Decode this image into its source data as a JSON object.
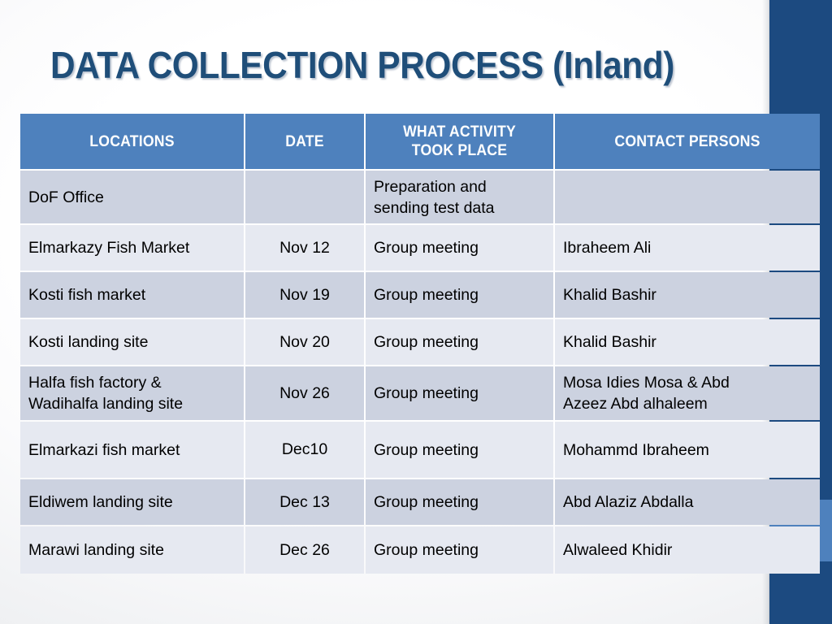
{
  "slide": {
    "title": "DATA COLLECTION PROCESS (Inland)",
    "accent_color": "#4e81bd",
    "title_color": "#1f4e79",
    "sidebar_color": "#1c4a80",
    "row_dark_color": "#ccd2e0",
    "row_light_color": "#e6e9f1"
  },
  "table": {
    "headers": {
      "locations": "LOCATIONS",
      "date": "DATE",
      "activity_line1": "WHAT ACTIVITY",
      "activity_line2": "TOOK PLACE",
      "contact": "CONTACT PERSONS"
    },
    "rows": [
      {
        "location": "DoF Office",
        "date": "",
        "activity": "Preparation and\nsending test data",
        "contact": ""
      },
      {
        "location": "Elmarkazy Fish Market",
        "date": "Nov 12",
        "activity": "Group meeting",
        "contact": "Ibraheem Ali"
      },
      {
        "location": "Kosti fish market",
        "date": "Nov 19",
        "activity": "Group meeting",
        "contact": "Khalid Bashir"
      },
      {
        "location": "Kosti landing site",
        "date": "Nov 20",
        "activity": "Group meeting",
        "contact": "Khalid Bashir"
      },
      {
        "location": "Halfa fish factory &\nWadihalfa landing site",
        "date": "Nov 26",
        "activity": "Group meeting",
        "contact": "Mosa Idies Mosa & Abd\nAzeez Abd alhaleem"
      },
      {
        "location": "Elmarkazi fish market",
        "date": "Dec10",
        "activity": "Group meeting",
        "contact": "Mohammd Ibraheem"
      },
      {
        "location": "Eldiwem landing site",
        "date": "Dec 13",
        "activity": "Group meeting",
        "contact": "Abd Alaziz Abdalla"
      },
      {
        "location": "Marawi landing site",
        "date": "Dec 26",
        "activity": "Group meeting",
        "contact": "Alwaleed Khidir"
      }
    ]
  }
}
